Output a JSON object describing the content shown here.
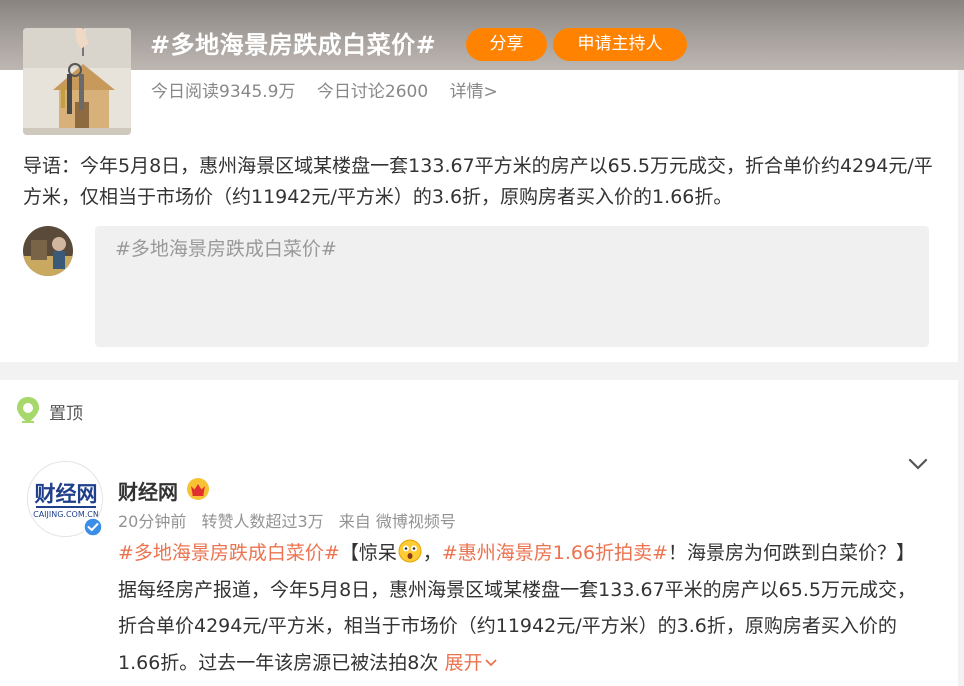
{
  "topic": {
    "title": "#多地海景房跌成白菜价#",
    "share_label": "分享",
    "host_label": "申请主持人",
    "reads": "今日阅读9345.9万",
    "discussions": "今日讨论2600",
    "details": "详情>",
    "intro": "导语：今年5月8日，惠州海景区域某楼盘一套133.67平方米的房产以65.5万元成交，折合单价约4294元/平方米，仅相当于市场价（约11942元/平方米）的3.6折，原购房者买入价的1.66折。"
  },
  "composer": {
    "value": "#多地海景房跌成白菜价#"
  },
  "feed": {
    "pinned_label": "置顶",
    "post": {
      "avatar_text": "财经网",
      "avatar_url_text": "CAIJING.COM.CN",
      "author": "财经网",
      "time": "20分钟前",
      "reposts": "转赞人数超过3万",
      "source": "来自 微博视频号",
      "tag1": "#多地海景房跌成白菜价#",
      "text1": "【惊呆",
      "text2": "，",
      "tag2": "#惠州海景房1.66折拍卖#",
      "text3": "！海景房为何跌到白菜价？】据每经房产报道，今年5月8日，惠州海景区域某楼盘一套133.67平米的房产以65.5万元成交，折合单价4294元/平方米，相当于市场价（约11942元/平方米）的3.6折，原购房者买入价的1.66折。过去一年该房源已被法拍8次",
      "expand": "展开"
    }
  },
  "colors": {
    "accent": "#ff8200",
    "tag": "#eb7350"
  }
}
